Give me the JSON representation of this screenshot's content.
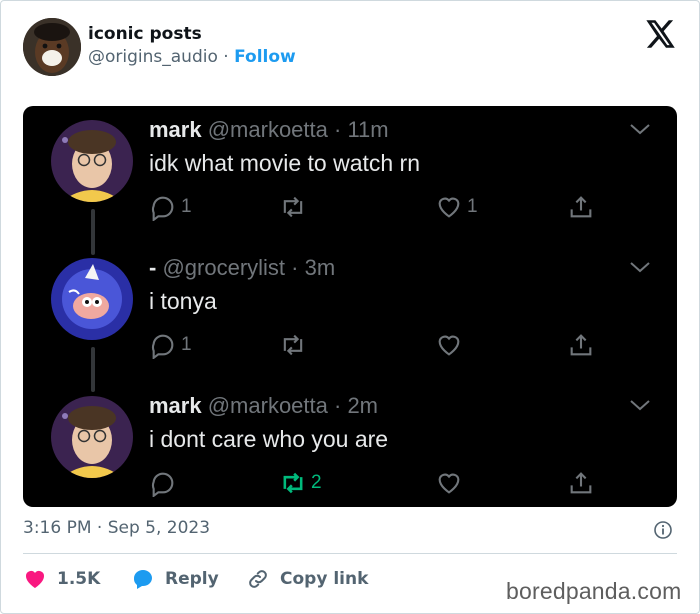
{
  "header": {
    "display_name": "iconic posts",
    "handle": "@origins_audio",
    "separator": "·",
    "follow_label": "Follow"
  },
  "screenshot": {
    "tweets": [
      {
        "name": "mark",
        "handle": "@markoetta",
        "time": "11m",
        "text": "idk what movie to watch rn",
        "replies": "1",
        "retweets": "",
        "likes": "1",
        "retweeted": false,
        "avatar_icon": "person-avatar-icon"
      },
      {
        "name": "-",
        "handle": "@grocerylist",
        "time": "3m",
        "text": "i tonya",
        "replies": "1",
        "retweets": "",
        "likes": "",
        "retweeted": false,
        "avatar_icon": "cartoon-avatar-icon"
      },
      {
        "name": "mark",
        "handle": "@markoetta",
        "time": "2m",
        "text": "i dont care who you are",
        "replies": "",
        "retweets": "2",
        "likes": "",
        "retweeted": true,
        "avatar_icon": "person-avatar-icon"
      }
    ]
  },
  "footer": {
    "timestamp": "3:16 PM · Sep 5, 2023",
    "like_count": "1.5K",
    "reply_label": "Reply",
    "copy_link_label": "Copy link"
  },
  "watermark": "boredpanda.com",
  "colors": {
    "follow_blue": "#1d9bf0",
    "like_pink": "#f91880",
    "retweet_green": "#00ba7c",
    "muted_gray": "#536471",
    "dark_bg": "#000000"
  }
}
